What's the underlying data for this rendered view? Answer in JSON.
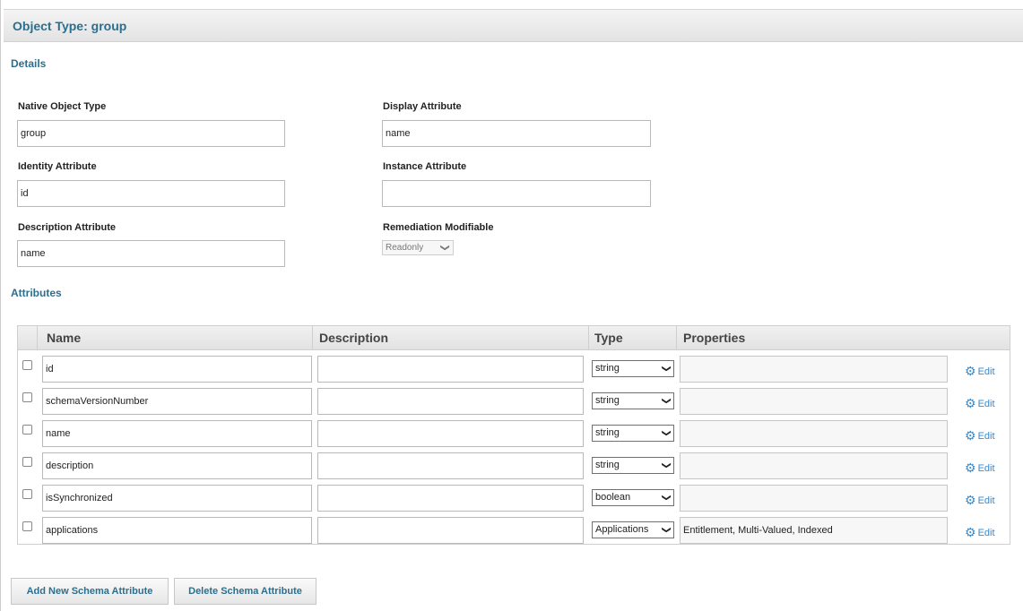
{
  "header": {
    "title": "Object Type: group"
  },
  "details": {
    "heading": "Details",
    "native_object_type": {
      "label": "Native Object Type",
      "value": "group"
    },
    "display_attribute": {
      "label": "Display Attribute",
      "value": "name"
    },
    "identity_attribute": {
      "label": "Identity Attribute",
      "value": "id"
    },
    "instance_attribute": {
      "label": "Instance Attribute",
      "value": ""
    },
    "description_attribute": {
      "label": "Description Attribute",
      "value": "name"
    },
    "remediation_modifiable": {
      "label": "Remediation Modifiable",
      "value": "Readonly"
    }
  },
  "attributes": {
    "heading": "Attributes",
    "columns": [
      "Name",
      "Description",
      "Type",
      "Properties"
    ],
    "edit_label": "Edit",
    "rows": [
      {
        "name": "id",
        "description": "",
        "type": "string",
        "properties": ""
      },
      {
        "name": "schemaVersionNumber",
        "description": "",
        "type": "string",
        "properties": ""
      },
      {
        "name": "name",
        "description": "",
        "type": "string",
        "properties": ""
      },
      {
        "name": "description",
        "description": "",
        "type": "string",
        "properties": ""
      },
      {
        "name": "isSynchronized",
        "description": "",
        "type": "boolean",
        "properties": ""
      },
      {
        "name": "applications",
        "description": "",
        "type": "Applications",
        "properties": "Entitlement, Multi-Valued, Indexed"
      }
    ]
  },
  "actions": {
    "add_label": "Add New Schema Attribute",
    "delete_label": "Delete Schema Attribute"
  },
  "colors": {
    "accent": "#2b6f8e",
    "link": "#3a89c9"
  }
}
